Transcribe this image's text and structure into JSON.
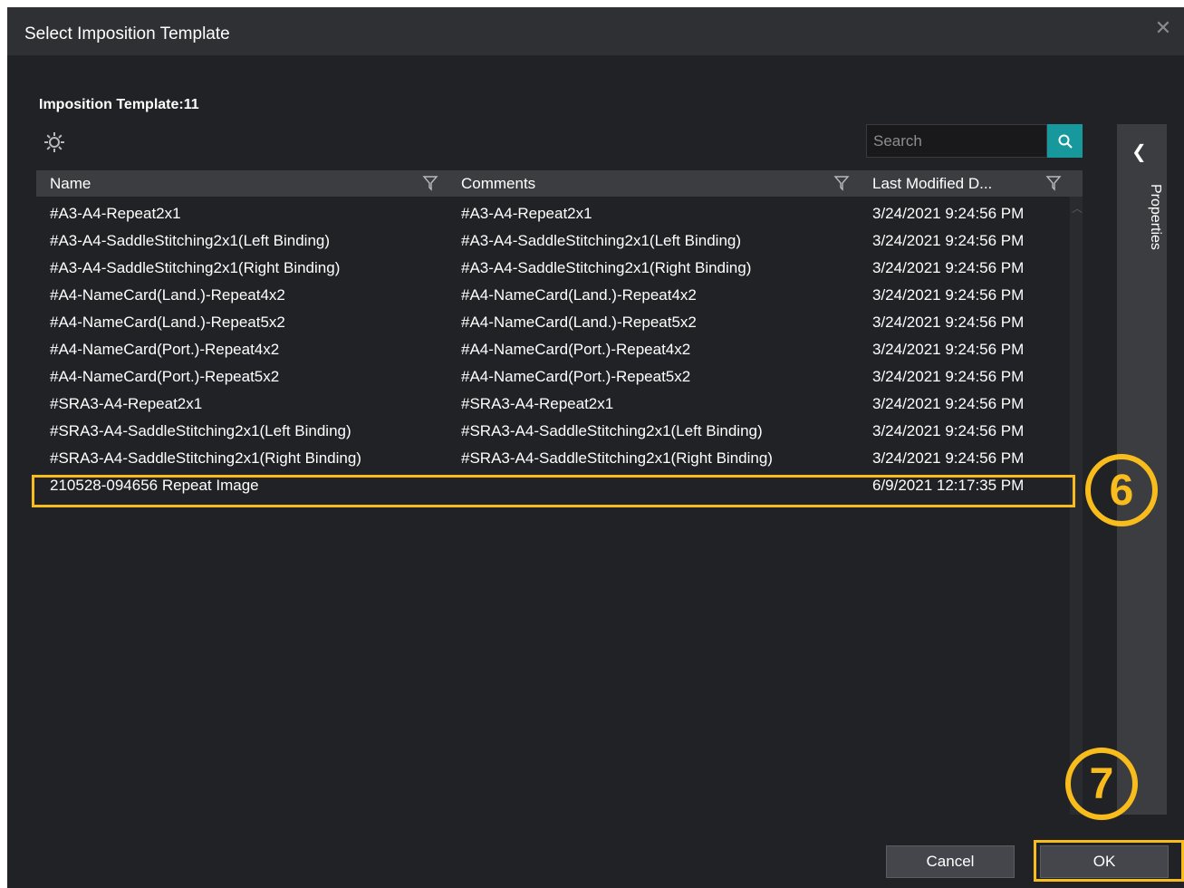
{
  "dialog": {
    "title": "Select Imposition Template",
    "close_icon": "close-icon"
  },
  "toolbar": {
    "count_label": "Imposition Template:11",
    "settings_icon": "gear-icon",
    "search_placeholder": "Search",
    "search_icon": "search-icon"
  },
  "properties_panel": {
    "label": "Properties",
    "chevron_icon": "chevron-left-icon"
  },
  "table": {
    "columns": [
      "Name",
      "Comments",
      "Last Modified D..."
    ],
    "rows": [
      {
        "name": "#A3-A4-Repeat2x1",
        "comments": "#A3-A4-Repeat2x1",
        "modified": "3/24/2021 9:24:56 PM"
      },
      {
        "name": "#A3-A4-SaddleStitching2x1(Left Binding)",
        "comments": "#A3-A4-SaddleStitching2x1(Left Binding)",
        "modified": "3/24/2021 9:24:56 PM"
      },
      {
        "name": "#A3-A4-SaddleStitching2x1(Right Binding)",
        "comments": "#A3-A4-SaddleStitching2x1(Right Binding)",
        "modified": "3/24/2021 9:24:56 PM"
      },
      {
        "name": "#A4-NameCard(Land.)-Repeat4x2",
        "comments": "#A4-NameCard(Land.)-Repeat4x2",
        "modified": "3/24/2021 9:24:56 PM"
      },
      {
        "name": "#A4-NameCard(Land.)-Repeat5x2",
        "comments": "#A4-NameCard(Land.)-Repeat5x2",
        "modified": "3/24/2021 9:24:56 PM"
      },
      {
        "name": "#A4-NameCard(Port.)-Repeat4x2",
        "comments": "#A4-NameCard(Port.)-Repeat4x2",
        "modified": "3/24/2021 9:24:56 PM"
      },
      {
        "name": "#A4-NameCard(Port.)-Repeat5x2",
        "comments": "#A4-NameCard(Port.)-Repeat5x2",
        "modified": "3/24/2021 9:24:56 PM"
      },
      {
        "name": "#SRA3-A4-Repeat2x1",
        "comments": "#SRA3-A4-Repeat2x1",
        "modified": "3/24/2021 9:24:56 PM"
      },
      {
        "name": "#SRA3-A4-SaddleStitching2x1(Left Binding)",
        "comments": "#SRA3-A4-SaddleStitching2x1(Left Binding)",
        "modified": "3/24/2021 9:24:56 PM"
      },
      {
        "name": "#SRA3-A4-SaddleStitching2x1(Right Binding)",
        "comments": "#SRA3-A4-SaddleStitching2x1(Right Binding)",
        "modified": "3/24/2021 9:24:56 PM"
      },
      {
        "name": "210528-094656 Repeat Image",
        "comments": "",
        "modified": "6/9/2021 12:17:35 PM"
      }
    ]
  },
  "annotations": {
    "step6": "6",
    "step7": "7",
    "color": "#f8bc1d"
  },
  "buttons": {
    "cancel": "Cancel",
    "ok": "OK"
  },
  "colors": {
    "background": "#212225",
    "titlebar": "#2f3034",
    "header": "#3c3d41",
    "accent": "#17989c"
  }
}
